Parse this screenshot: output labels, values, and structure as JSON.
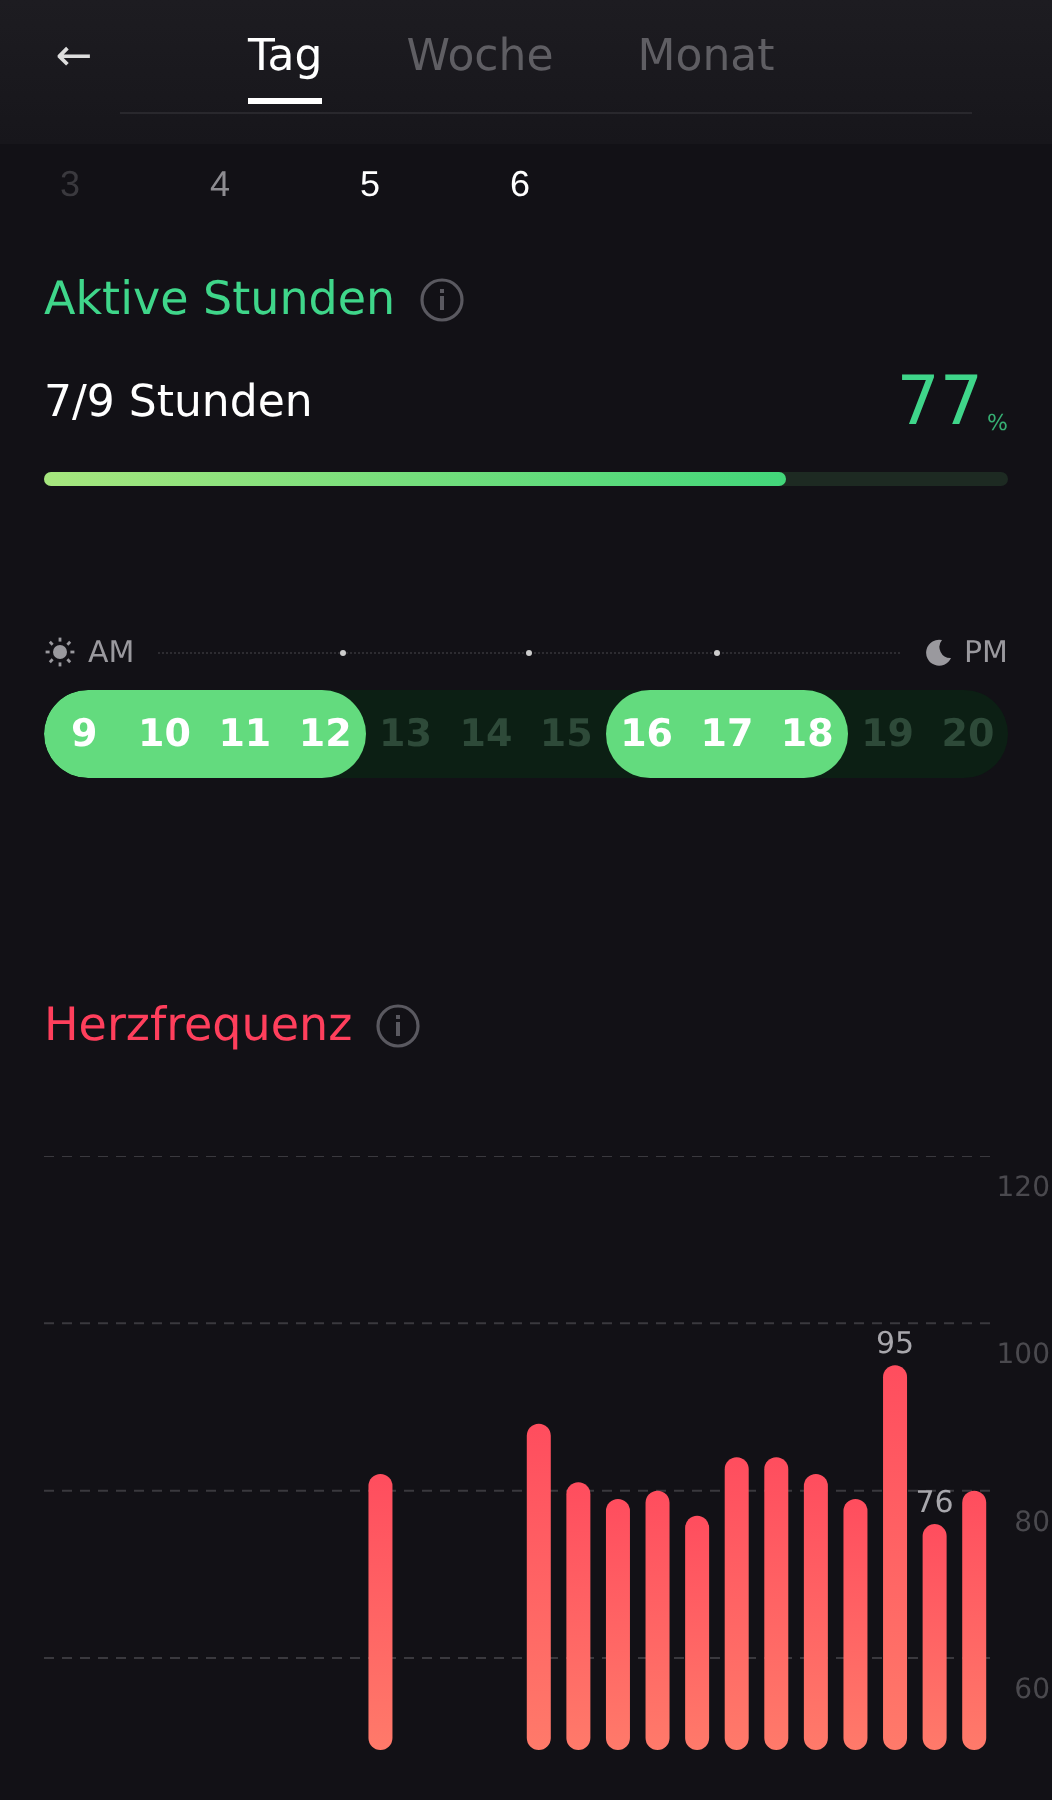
{
  "header": {
    "back": "←",
    "tabs": [
      {
        "label": "Tag",
        "selected": true
      },
      {
        "label": "Woche",
        "selected": false
      },
      {
        "label": "Monat",
        "selected": false
      }
    ]
  },
  "days": [
    {
      "label": "3",
      "color": "#3a393e"
    },
    {
      "label": "4",
      "color": "#8d8c91"
    },
    {
      "label": "5",
      "color": "#ffffff"
    },
    {
      "label": "6",
      "color": "#ffffff"
    }
  ],
  "active_hours": {
    "title": "Aktive Stunden",
    "summary": "7/9 Stunden",
    "percent": "77",
    "unit": "%",
    "level": 0.77,
    "am_label": "AM",
    "pm_label": "PM",
    "hours": [
      {
        "label": "9",
        "active": true
      },
      {
        "label": "10",
        "active": true
      },
      {
        "label": "11",
        "active": true
      },
      {
        "label": "12",
        "active": true
      },
      {
        "label": "13",
        "active": false
      },
      {
        "label": "14",
        "active": false
      },
      {
        "label": "15",
        "active": false
      },
      {
        "label": "16",
        "active": true
      },
      {
        "label": "17",
        "active": true
      },
      {
        "label": "18",
        "active": true
      },
      {
        "label": "19",
        "active": false
      },
      {
        "label": "20",
        "active": false
      }
    ]
  },
  "heart_rate": {
    "title": "Herzfrequenz",
    "chart_data": {
      "type": "bar",
      "grid": true,
      "ylim": [
        49,
        120
      ],
      "yticks": [
        60,
        80,
        100,
        120
      ],
      "values": [
        null,
        null,
        null,
        null,
        null,
        null,
        null,
        null,
        82,
        null,
        null,
        null,
        88,
        81,
        79,
        80,
        77,
        84,
        84,
        82,
        79,
        95,
        76,
        80
      ],
      "annotations": [
        {
          "y": 95,
          "text": "95"
        },
        {
          "y": 76,
          "text": "76"
        }
      ]
    }
  }
}
